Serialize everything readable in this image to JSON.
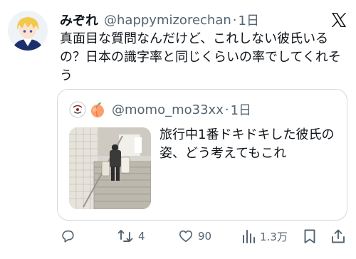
{
  "tweet": {
    "display_name": "みぞれ",
    "handle": "@happymizorechan",
    "separator": "·",
    "time": "1日",
    "text": "真面目な質問なんだけど、これしない彼氏いるの？日本の識字率と同じくらいの率でしてくれそう"
  },
  "quote": {
    "handle": "@momo_mo33xx",
    "separator": "·",
    "time": "1日",
    "text": "旅行中1番ドキドキした彼氏の姿、どう考えてもこれ"
  },
  "actions": {
    "retweets": "4",
    "likes": "90",
    "views": "1.3万"
  },
  "icons": {
    "platform": "x-logo-icon",
    "retweet": "retweet-icon",
    "like": "heart-icon",
    "views": "views-bar-chart-icon",
    "bookmark": "bookmark-icon",
    "share": "share-icon",
    "peach": "peach-emoji-icon"
  },
  "colors": {
    "text": "#0f1419",
    "secondary": "#536471",
    "border": "#cfd9de"
  }
}
